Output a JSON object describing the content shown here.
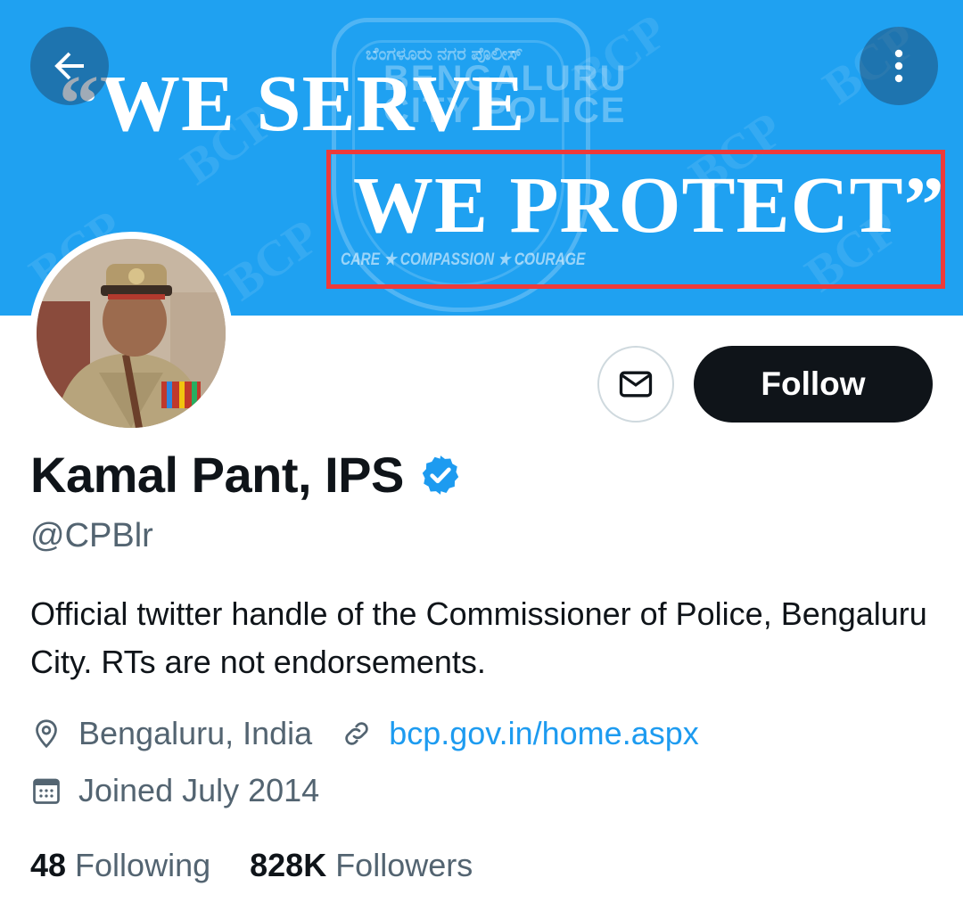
{
  "banner": {
    "slogan_line1": "“WE SERVE",
    "slogan_line2": "WE PROTECT”",
    "watermark": "BCP",
    "badge_kannada": "ಬೆಂಗಳೂರು ನಗರ ಪೊಲೀಸ್",
    "badge_line1": "BENGALURU",
    "badge_line2": "CITY POLICE",
    "badge_motto": "CARE ★ COMPASSION ★ COURAGE",
    "background_color": "#1fa1f1",
    "highlight_color": "#ee3a3a"
  },
  "nav": {
    "back_icon": "arrow-left-icon",
    "more_icon": "more-vertical-icon"
  },
  "profile": {
    "name": "Kamal Pant, IPS",
    "handle": "@CPBlr",
    "verified_color": "#1d9bf0",
    "bio": "Official twitter handle of the Commissioner of Police, Bengaluru City. RTs are not endorsements.",
    "location": "Bengaluru, India",
    "website": "bcp.gov.in/home.aspx",
    "joined": "Joined July 2014"
  },
  "actions": {
    "message_icon": "envelope-icon",
    "follow_label": "Follow"
  },
  "stats": {
    "following_count": "48",
    "following_label": "Following",
    "followers_count": "828K",
    "followers_label": "Followers"
  }
}
